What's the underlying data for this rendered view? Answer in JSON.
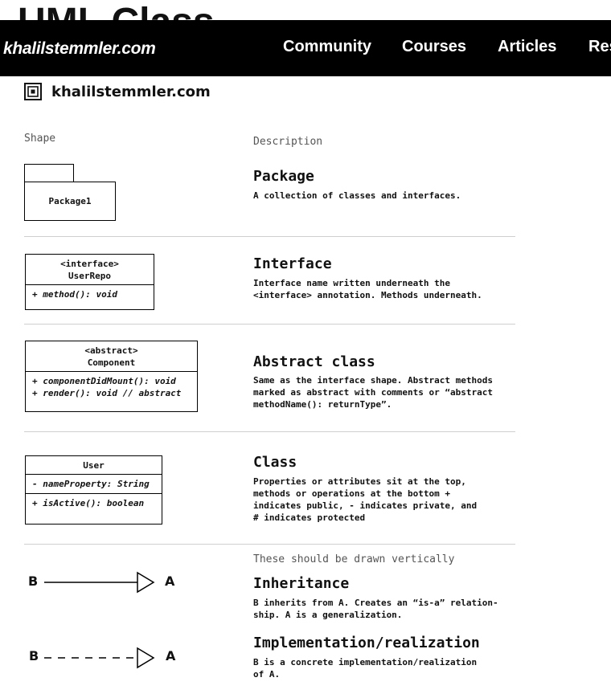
{
  "header": {
    "background_title": "UML Class Diagram",
    "brand": "khalilstemmler.com",
    "nav": [
      {
        "label": "Community"
      },
      {
        "label": "Courses"
      },
      {
        "label": "Articles"
      },
      {
        "label": "Res"
      }
    ]
  },
  "sheet": {
    "logo_text": "khalilstemmler.com",
    "col_shape": "Shape",
    "col_description": "Description"
  },
  "rows": {
    "package": {
      "title": "Package",
      "description": "A collection of classes and interfaces.",
      "shape_label": "Package1"
    },
    "interface": {
      "title": "Interface",
      "description": "Interface name written underneath the\n<interface> annotation. Methods underneath.",
      "stereotype": "<interface>",
      "name": "UserRepo",
      "method": "+ method(): void"
    },
    "abstract": {
      "title": "Abstract class",
      "description": "Same as the interface shape. Abstract methods\nmarked as abstract with comments or “abstract\nmethodName(): returnType”.",
      "stereotype": "<abstract>",
      "name": "Component",
      "method1": "+ componentDidMount(): void",
      "method2": "+ render(): void // abstract"
    },
    "class": {
      "title": "Class",
      "description": "Properties or attributes sit at the top,\nmethods or operations at the bottom +\nindicates public, - indicates private, and\n# indicates protected",
      "name": "User",
      "property": "- nameProperty: String",
      "method": "+ isActive(): boolean"
    }
  },
  "relations": {
    "note": "These should be drawn vertically",
    "inheritance": {
      "title": "Inheritance",
      "description": "B inherits from A. Creates an “is-a” relation-\nship. A is a generalization.",
      "from": "B",
      "to": "A"
    },
    "implementation": {
      "title": "Implementation/realization",
      "description": "B is a concrete implementation/realization\nof A.",
      "from": "B",
      "to": "A"
    }
  }
}
